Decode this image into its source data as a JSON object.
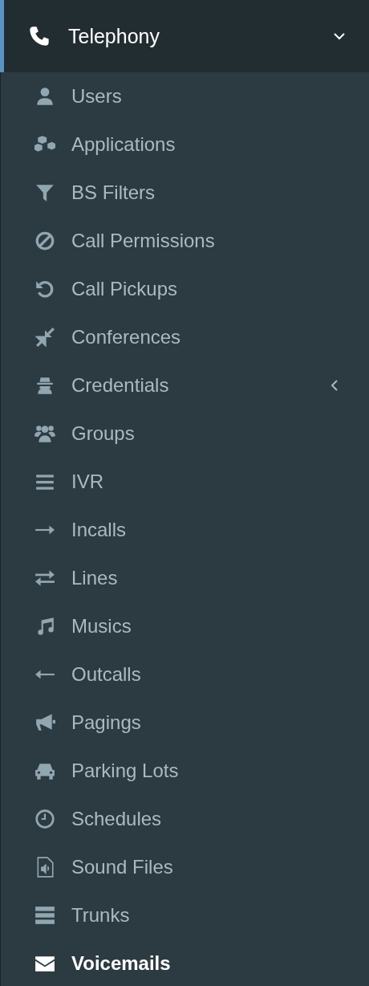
{
  "menu": {
    "label": "Telephony",
    "expanded": true,
    "items": [
      {
        "label": "Users",
        "selected": false
      },
      {
        "label": "Applications",
        "selected": false
      },
      {
        "label": "BS Filters",
        "selected": false
      },
      {
        "label": "Call Permissions",
        "selected": false
      },
      {
        "label": "Call Pickups",
        "selected": false
      },
      {
        "label": "Conferences",
        "selected": false
      },
      {
        "label": "Credentials",
        "selected": false,
        "expanded": false
      },
      {
        "label": "Groups",
        "selected": false
      },
      {
        "label": "IVR",
        "selected": false
      },
      {
        "label": "Incalls",
        "selected": false
      },
      {
        "label": "Lines",
        "selected": false
      },
      {
        "label": "Musics",
        "selected": false
      },
      {
        "label": "Outcalls",
        "selected": false
      },
      {
        "label": "Pagings",
        "selected": false
      },
      {
        "label": "Parking Lots",
        "selected": false
      },
      {
        "label": "Schedules",
        "selected": false
      },
      {
        "label": "Sound Files",
        "selected": false
      },
      {
        "label": "Trunks",
        "selected": false
      },
      {
        "label": "Voicemails",
        "selected": true
      }
    ]
  }
}
